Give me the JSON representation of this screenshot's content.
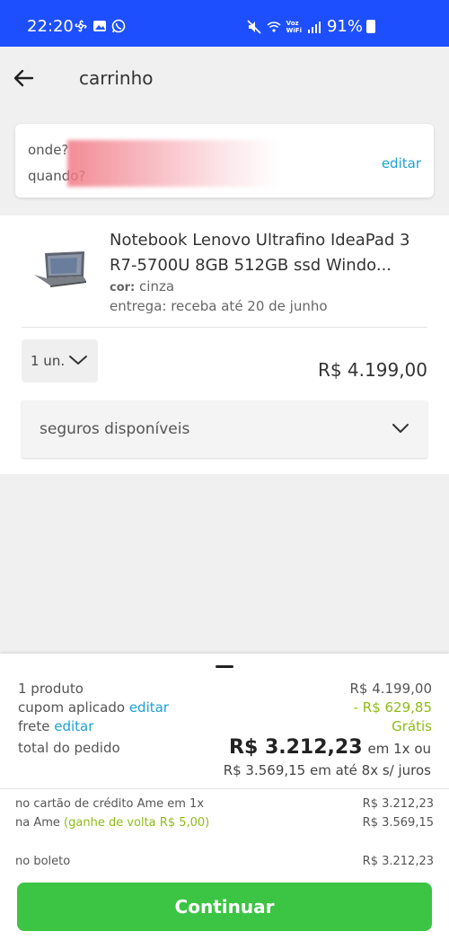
{
  "status_bar": {
    "time": "22:20",
    "left_icons": [
      "pinwheel-icon",
      "gallery-icon",
      "whatsapp-icon"
    ],
    "right_icons": [
      "mute-icon",
      "wifi-calling-icon",
      "signal-icon"
    ],
    "vowifi_label": "Voz\nWiFi",
    "battery": "91%"
  },
  "header": {
    "title": "carrinho"
  },
  "address": {
    "line1": "onde?",
    "line2": "quando?",
    "edit_label": "editar"
  },
  "product": {
    "name": "Notebook Lenovo Ultrafino IdeaPad 3 R7-5700U 8GB 512GB ssd Windo...",
    "color_label": "cor:",
    "color_value": "cinza",
    "delivery": "entrega: receba até 20 de junho",
    "quantity": "1 un.",
    "price": "R$ 4.199,00",
    "insurance_label": "seguros disponíveis"
  },
  "summary": {
    "products_label": "1 produto",
    "products_value": "R$ 4.199,00",
    "coupon_label": "cupom aplicado",
    "coupon_edit": "editar",
    "coupon_value": "- R$ 629,85",
    "shipping_label": "frete",
    "shipping_edit": "editar",
    "shipping_value": "Grátis",
    "total_label": "total do pedido",
    "total_value": "R$ 3.212,23",
    "total_suffix": "em 1x ou",
    "installments": "R$ 3.569,15 em até 8x s/ juros",
    "payment_options": [
      {
        "label": "no cartão de crédito Ame em 1x",
        "value": "R$ 3.212,23"
      },
      {
        "label": "na Ame",
        "extra": "(ganhe de volta R$ 5,00)",
        "value": "R$ 3.569,15"
      },
      {
        "label": "no boleto",
        "value": "R$ 3.212,23"
      }
    ],
    "continue_label": "Continuar"
  },
  "colors": {
    "status_bar": "#1e4fff",
    "link": "#1ea0d5",
    "green_text": "#8ebc17",
    "continue_button": "#3cc444"
  }
}
